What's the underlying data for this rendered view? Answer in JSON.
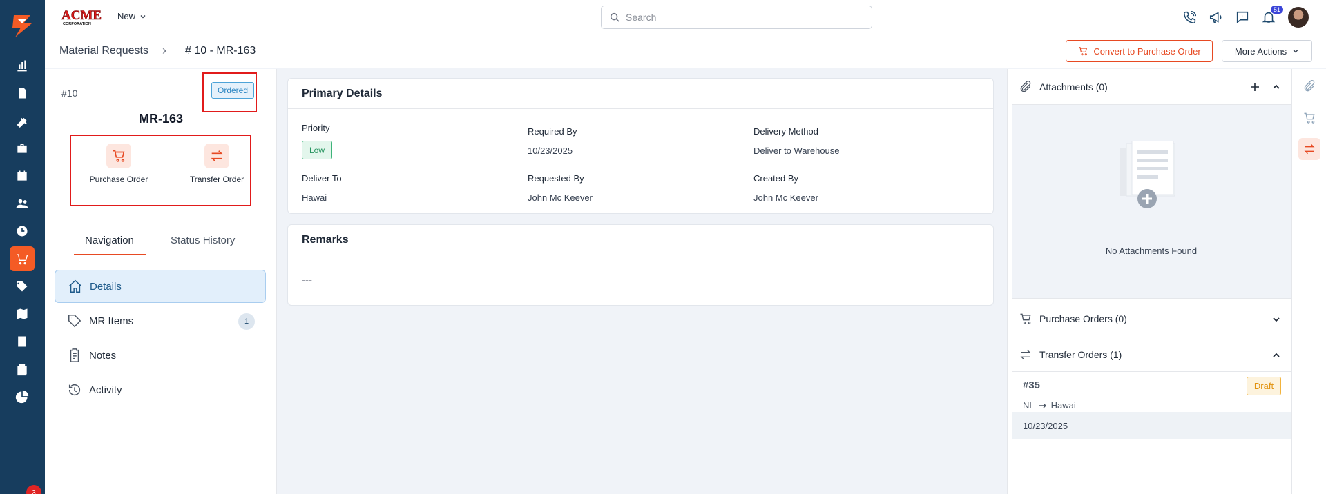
{
  "topbar": {
    "brand_text": "ACME",
    "brand_sub": "CORPORATION",
    "new_label": "New",
    "search_placeholder": "Search",
    "notification_count": "51"
  },
  "rail": {
    "badge_count": "3"
  },
  "breadcrumb": {
    "parent": "Material Requests",
    "separator": "›",
    "current": "# 10 - MR-163"
  },
  "actions": {
    "convert_label": "Convert to Purchase Order",
    "more_label": "More Actions"
  },
  "record": {
    "number": "#10",
    "status": "Ordered",
    "title": "MR-163",
    "quick_actions": [
      {
        "label": "Purchase Order",
        "icon": "cart-dollar-icon"
      },
      {
        "label": "Transfer Order",
        "icon": "transfer-arrows-icon"
      }
    ]
  },
  "tabs": [
    {
      "label": "Navigation"
    },
    {
      "label": "Status History"
    }
  ],
  "nav": [
    {
      "label": "Details",
      "icon": "home-icon"
    },
    {
      "label": "MR Items",
      "icon": "tag-icon",
      "count": "1"
    },
    {
      "label": "Notes",
      "icon": "clipboard-icon"
    },
    {
      "label": "Activity",
      "icon": "history-icon"
    }
  ],
  "primary": {
    "title": "Primary Details",
    "priority_label": "Priority",
    "priority_value": "Low",
    "required_by_label": "Required By",
    "required_by_value": "10/23/2025",
    "delivery_method_label": "Delivery Method",
    "delivery_method_value": "Deliver to Warehouse",
    "deliver_to_label": "Deliver To",
    "deliver_to_value": "Hawai",
    "requested_by_label": "Requested By",
    "requested_by_value": "John Mc Keever",
    "created_by_label": "Created By",
    "created_by_value": "John Mc Keever"
  },
  "remarks": {
    "title": "Remarks",
    "value": "---"
  },
  "right": {
    "attachments_title": "Attachments (0)",
    "attachments_empty": "No Attachments Found",
    "purchase_orders_title": "Purchase Orders (0)",
    "transfer_orders_title": "Transfer Orders (1)",
    "transfer_order": {
      "number": "#35",
      "status": "Draft",
      "from": "NL",
      "to": "Hawai",
      "date": "10/23/2025"
    }
  }
}
